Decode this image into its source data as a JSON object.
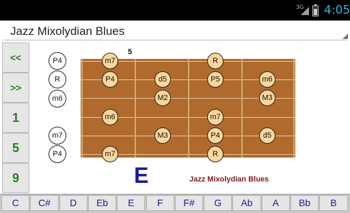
{
  "status_bar": {
    "network": "3G",
    "time": "4:05"
  },
  "scale_selector": {
    "selected": "Jazz Mixolydian Blues"
  },
  "side_buttons": [
    "<<",
    ">>",
    "1",
    "5",
    "9"
  ],
  "fretboard": {
    "start_fret": "5",
    "tuning_labels": [
      "P4",
      "R",
      "m6",
      "",
      "m7",
      "P4"
    ],
    "notes": [
      {
        "label": "m7",
        "fret": 1,
        "string": 0
      },
      {
        "label": "R",
        "fret": 4,
        "string": 0
      },
      {
        "label": "P4",
        "fret": 1,
        "string": 1
      },
      {
        "label": "d5",
        "fret": 2,
        "string": 1
      },
      {
        "label": "P5",
        "fret": 4,
        "string": 1
      },
      {
        "label": "m6",
        "fret": 5,
        "string": 1
      },
      {
        "label": "M2",
        "fret": 2,
        "string": 2
      },
      {
        "label": "M3",
        "fret": 5,
        "string": 2
      },
      {
        "label": "m6",
        "fret": 1,
        "string": 3
      },
      {
        "label": "m7",
        "fret": 4,
        "string": 3
      },
      {
        "label": "M3",
        "fret": 2,
        "string": 4
      },
      {
        "label": "P4",
        "fret": 4,
        "string": 4
      },
      {
        "label": "d5",
        "fret": 5,
        "string": 4
      },
      {
        "label": "m7",
        "fret": 1,
        "string": 5
      },
      {
        "label": "R",
        "fret": 4,
        "string": 5
      }
    ]
  },
  "key": "E",
  "scale_label": "Jazz Mixolydian Blues",
  "key_buttons": [
    "C",
    "C#",
    "D",
    "Eb",
    "E",
    "F",
    "F#",
    "G",
    "Ab",
    "A",
    "Bb",
    "B"
  ]
}
